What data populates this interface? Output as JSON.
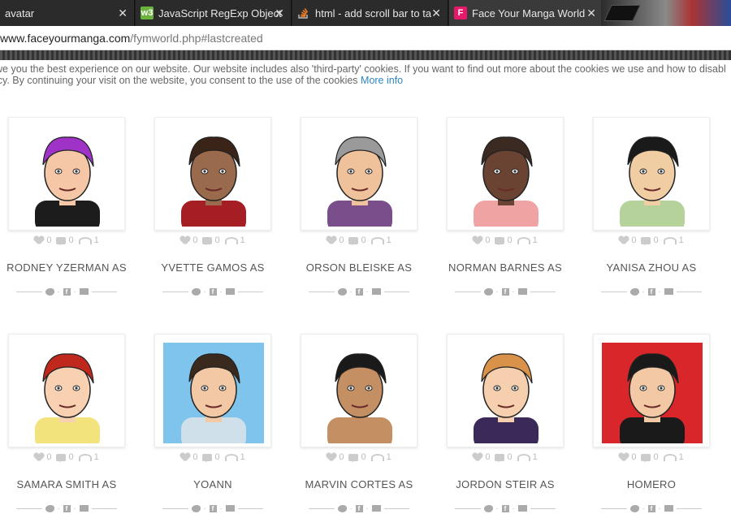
{
  "browser": {
    "tabs": [
      {
        "title": "avatar",
        "icon": "blank-icon",
        "active": false
      },
      {
        "title": "JavaScript RegExp Object",
        "icon": "w3schools-icon",
        "active": false
      },
      {
        "title": "html - add scroll bar to ta",
        "icon": "stackoverflow-icon",
        "active": false
      },
      {
        "title": "Face Your Manga World",
        "icon": "faceyourmanga-icon",
        "active": true
      }
    ],
    "url_host": "www.faceyourmanga.com",
    "url_path": "/fymworld.php#lastcreated"
  },
  "cookie_notice": {
    "line1": "we you the best experience on our website. Our website includes also 'third-party' cookies. If you want to find out more about the cookies we use and how to disabl",
    "line2": "icy. By continuing your visit on the website, you consent to the use of the cookies",
    "link": "More info"
  },
  "avatars": [
    {
      "name": "RODNEY YZERMAN AS",
      "likes": "0",
      "comments": "0",
      "views": "1",
      "bg": "#ffffff",
      "hair": "#a033c7",
      "skin": "#f5c7a6",
      "shirt": "#1c1c1c"
    },
    {
      "name": "YVETTE GAMOS AS",
      "likes": "0",
      "comments": "0",
      "views": "1",
      "bg": "#ffffff",
      "hair": "#3a2417",
      "skin": "#9a6a4c",
      "shirt": "#a51e24"
    },
    {
      "name": "ORSON BLEISKE AS",
      "likes": "0",
      "comments": "0",
      "views": "1",
      "bg": "#ffffff",
      "hair": "#9a9a9a",
      "skin": "#efc29c",
      "shirt": "#7a4e8a"
    },
    {
      "name": "NORMAN BARNES AS",
      "likes": "0",
      "comments": "0",
      "views": "1",
      "bg": "#ffffff",
      "hair": "#3b2a22",
      "skin": "#6a4332",
      "shirt": "#f0a3a3"
    },
    {
      "name": "YANISA ZHOU AS",
      "likes": "0",
      "comments": "0",
      "views": "1",
      "bg": "#ffffff",
      "hair": "#1a1a1a",
      "skin": "#f1cda3",
      "shirt": "#b4d29a"
    },
    {
      "name": "SAMARA SMITH AS",
      "likes": "0",
      "comments": "0",
      "views": "1",
      "bg": "#ffffff",
      "hair": "#c0281e",
      "skin": "#f8d1b2",
      "shirt": "#f2e37c"
    },
    {
      "name": "YOANN",
      "likes": "0",
      "comments": "0",
      "views": "1",
      "bg": "#7ec4ec",
      "hair": "#3a2a1e",
      "skin": "#f2c9a4",
      "shirt": "#cfe0ea"
    },
    {
      "name": "MARVIN CORTES AS",
      "likes": "0",
      "comments": "0",
      "views": "1",
      "bg": "#ffffff",
      "hair": "#1a1a1a",
      "skin": "#c48f62",
      "shirt": "#c48f62"
    },
    {
      "name": "JORDON STEIR AS",
      "likes": "0",
      "comments": "0",
      "views": "1",
      "bg": "#ffffff",
      "hair": "#d8924a",
      "skin": "#f5cfae",
      "shirt": "#3a2a5a"
    },
    {
      "name": "HOMERO",
      "likes": "0",
      "comments": "0",
      "views": "1",
      "bg": "#d8262a",
      "hair": "#1a1a1a",
      "skin": "#f2c9a4",
      "shirt": "#1a1a1a"
    }
  ]
}
